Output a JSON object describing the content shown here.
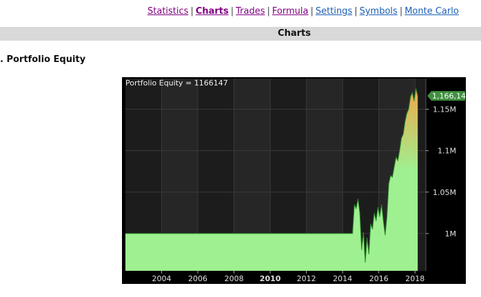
{
  "nav": {
    "items": [
      {
        "label": "Statistics",
        "state": "visited"
      },
      {
        "label": "Charts",
        "state": "active"
      },
      {
        "label": "Trades",
        "state": "visited"
      },
      {
        "label": "Formula",
        "state": "visited"
      },
      {
        "label": "Settings",
        "state": "link"
      },
      {
        "label": "Symbols",
        "state": "link"
      },
      {
        "label": "Monte Carlo",
        "state": "link"
      }
    ],
    "separator": "|"
  },
  "header": {
    "title": "Charts"
  },
  "section": {
    "title": ". Portfolio Equity"
  },
  "colors": {
    "plot_bg": "#1c1c1c",
    "alt_band": "#262626",
    "grid": "#3a3a3a",
    "fill_low": "#9ff090",
    "fill_high": "#f0a84a",
    "line": "#2a8a2a",
    "label_bg": "#3f8f3f"
  },
  "chart_data": {
    "type": "area",
    "title": "Portfolio Equity = 1166147",
    "last_value_label": "1,166,14",
    "x_ticks": [
      "2004",
      "2006",
      "2008",
      "2010",
      "2012",
      "2014",
      "2016",
      "2018"
    ],
    "x_tick_bold": "2010",
    "y_ticks": [
      {
        "label": "1M",
        "value": 1000000
      },
      {
        "label": "1.05M",
        "value": 1050000
      },
      {
        "label": "1.1M",
        "value": 1100000
      },
      {
        "label": "1.15M",
        "value": 1150000
      }
    ],
    "xlim": [
      2002.0,
      2018.6
    ],
    "ylim": [
      955000,
      1187000
    ],
    "grid": true,
    "series": [
      {
        "points": [
          [
            2002.0,
            1000000
          ],
          [
            2014.55,
            1000000
          ],
          [
            2014.65,
            1035000
          ],
          [
            2014.75,
            1030000
          ],
          [
            2014.85,
            1042000
          ],
          [
            2014.95,
            1025000
          ],
          [
            2015.05,
            980000
          ],
          [
            2015.15,
            1002000
          ],
          [
            2015.25,
            965000
          ],
          [
            2015.35,
            995000
          ],
          [
            2015.45,
            975000
          ],
          [
            2015.55,
            1012000
          ],
          [
            2015.65,
            1005000
          ],
          [
            2015.75,
            1025000
          ],
          [
            2015.85,
            1015000
          ],
          [
            2015.95,
            1032000
          ],
          [
            2016.05,
            1020000
          ],
          [
            2016.15,
            1035000
          ],
          [
            2016.25,
            1015000
          ],
          [
            2016.35,
            998000
          ],
          [
            2016.45,
            1020000
          ],
          [
            2016.55,
            1060000
          ],
          [
            2016.65,
            1070000
          ],
          [
            2016.75,
            1068000
          ],
          [
            2016.85,
            1080000
          ],
          [
            2016.95,
            1092000
          ],
          [
            2017.05,
            1088000
          ],
          [
            2017.15,
            1100000
          ],
          [
            2017.25,
            1115000
          ],
          [
            2017.35,
            1120000
          ],
          [
            2017.45,
            1135000
          ],
          [
            2017.55,
            1145000
          ],
          [
            2017.65,
            1150000
          ],
          [
            2017.75,
            1165000
          ],
          [
            2017.85,
            1170000
          ],
          [
            2017.95,
            1160000
          ],
          [
            2018.05,
            1175000
          ],
          [
            2018.15,
            1166147
          ]
        ]
      }
    ]
  }
}
